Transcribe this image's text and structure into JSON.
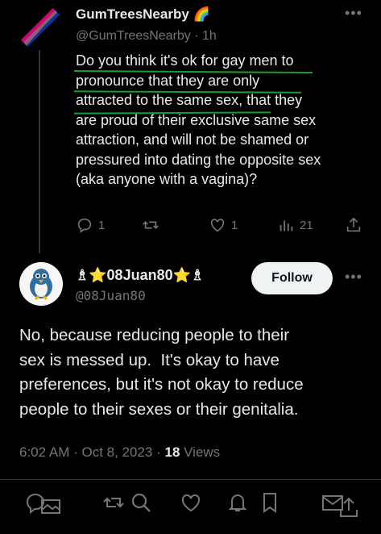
{
  "tweet_original": {
    "author_name": "GumTreesNearby",
    "author_emoji": "🌈",
    "handle": "@GumTreesNearby",
    "time": "1h",
    "lines": [
      "Do you think it's ok for gay men to",
      "pronounce that they are only",
      "attracted to the same sex, that they",
      "are proud of their exclusive same sex",
      "attraction, and will not be shamed or",
      "pressured into dating the opposite sex",
      "(aka anyone with a vagina)?"
    ],
    "reply_count": "1",
    "like_count": "1",
    "view_count": "21"
  },
  "tweet_reply": {
    "author_name": "♗⭐08Juan80⭐♗",
    "handle": "@08Juan80",
    "follow_label": "Follow",
    "lines": [
      "No, because reducing people to their",
      "sex is messed up.  It's okay to have",
      "preferences, but it's not okay to reduce",
      "people to their sexes or their genitalia."
    ],
    "time": "6:02 AM",
    "date": "Oct 8, 2023",
    "views_count": "18",
    "views_label": "Views"
  },
  "colors": {
    "background": "#000000",
    "text": "#e7e9ea",
    "muted": "#71767b",
    "underline": "#1a9e2c",
    "follow_bg": "#eff3f4"
  },
  "icons": [
    "reply-icon",
    "retweet-icon",
    "like-icon",
    "views-icon",
    "share-icon",
    "search-icon",
    "bookmark-icon"
  ]
}
